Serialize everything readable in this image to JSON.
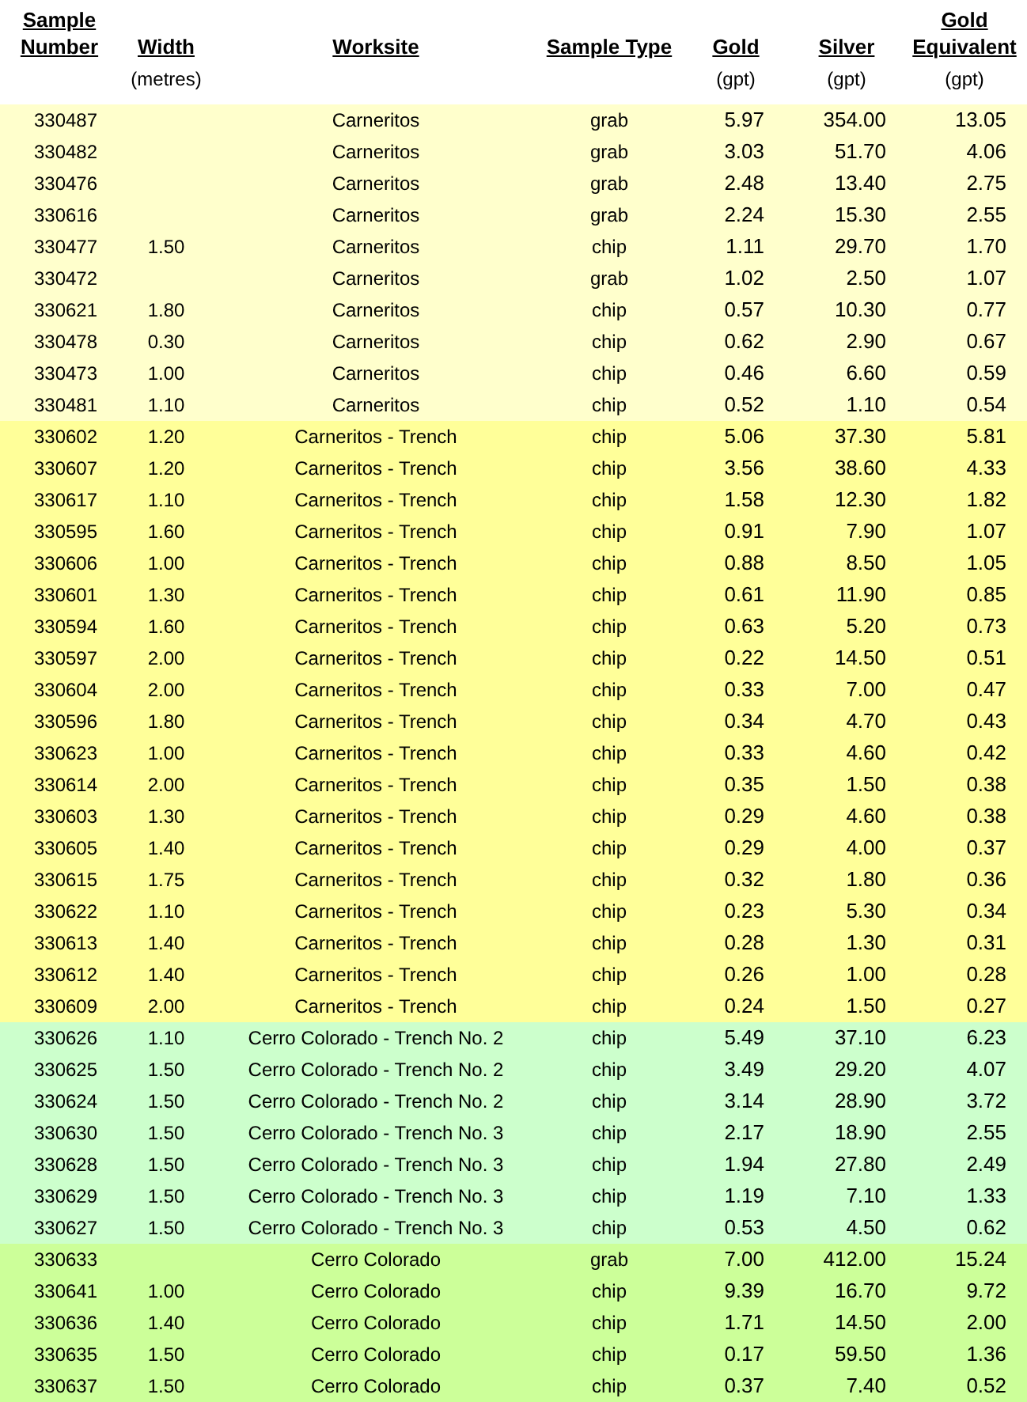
{
  "columns": [
    {
      "label": "Sample Number"
    },
    {
      "label": "Width",
      "unit": "(metres)"
    },
    {
      "label": "Worksite"
    },
    {
      "label": "Sample Type"
    },
    {
      "label": "Gold",
      "unit": "(gpt)"
    },
    {
      "label": "Silver",
      "unit": "(gpt)"
    },
    {
      "label": "Gold Equivalent",
      "unit": "(gpt)"
    }
  ],
  "groups": [
    {
      "color": "#ffffcc",
      "rows": [
        [
          "330487",
          "",
          "Carneritos",
          "grab",
          "5.97",
          "354.00",
          "13.05"
        ],
        [
          "330482",
          "",
          "Carneritos",
          "grab",
          "3.03",
          "51.70",
          "4.06"
        ],
        [
          "330476",
          "",
          "Carneritos",
          "grab",
          "2.48",
          "13.40",
          "2.75"
        ],
        [
          "330616",
          "",
          "Carneritos",
          "grab",
          "2.24",
          "15.30",
          "2.55"
        ],
        [
          "330477",
          "1.50",
          "Carneritos",
          "chip",
          "1.11",
          "29.70",
          "1.70"
        ],
        [
          "330472",
          "",
          "Carneritos",
          "grab",
          "1.02",
          "2.50",
          "1.07"
        ],
        [
          "330621",
          "1.80",
          "Carneritos",
          "chip",
          "0.57",
          "10.30",
          "0.77"
        ],
        [
          "330478",
          "0.30",
          "Carneritos",
          "chip",
          "0.62",
          "2.90",
          "0.67"
        ],
        [
          "330473",
          "1.00",
          "Carneritos",
          "chip",
          "0.46",
          "6.60",
          "0.59"
        ],
        [
          "330481",
          "1.10",
          "Carneritos",
          "chip",
          "0.52",
          "1.10",
          "0.54"
        ]
      ]
    },
    {
      "color": "#ffff99",
      "rows": [
        [
          "330602",
          "1.20",
          "Carneritos - Trench",
          "chip",
          "5.06",
          "37.30",
          "5.81"
        ],
        [
          "330607",
          "1.20",
          "Carneritos - Trench",
          "chip",
          "3.56",
          "38.60",
          "4.33"
        ],
        [
          "330617",
          "1.10",
          "Carneritos - Trench",
          "chip",
          "1.58",
          "12.30",
          "1.82"
        ],
        [
          "330595",
          "1.60",
          "Carneritos - Trench",
          "chip",
          "0.91",
          "7.90",
          "1.07"
        ],
        [
          "330606",
          "1.00",
          "Carneritos - Trench",
          "chip",
          "0.88",
          "8.50",
          "1.05"
        ],
        [
          "330601",
          "1.30",
          "Carneritos - Trench",
          "chip",
          "0.61",
          "11.90",
          "0.85"
        ],
        [
          "330594",
          "1.60",
          "Carneritos - Trench",
          "chip",
          "0.63",
          "5.20",
          "0.73"
        ],
        [
          "330597",
          "2.00",
          "Carneritos - Trench",
          "chip",
          "0.22",
          "14.50",
          "0.51"
        ],
        [
          "330604",
          "2.00",
          "Carneritos - Trench",
          "chip",
          "0.33",
          "7.00",
          "0.47"
        ],
        [
          "330596",
          "1.80",
          "Carneritos - Trench",
          "chip",
          "0.34",
          "4.70",
          "0.43"
        ],
        [
          "330623",
          "1.00",
          "Carneritos - Trench",
          "chip",
          "0.33",
          "4.60",
          "0.42"
        ],
        [
          "330614",
          "2.00",
          "Carneritos - Trench",
          "chip",
          "0.35",
          "1.50",
          "0.38"
        ],
        [
          "330603",
          "1.30",
          "Carneritos - Trench",
          "chip",
          "0.29",
          "4.60",
          "0.38"
        ],
        [
          "330605",
          "1.40",
          "Carneritos - Trench",
          "chip",
          "0.29",
          "4.00",
          "0.37"
        ],
        [
          "330615",
          "1.75",
          "Carneritos - Trench",
          "chip",
          "0.32",
          "1.80",
          "0.36"
        ],
        [
          "330622",
          "1.10",
          "Carneritos - Trench",
          "chip",
          "0.23",
          "5.30",
          "0.34"
        ],
        [
          "330613",
          "1.40",
          "Carneritos - Trench",
          "chip",
          "0.28",
          "1.30",
          "0.31"
        ],
        [
          "330612",
          "1.40",
          "Carneritos - Trench",
          "chip",
          "0.26",
          "1.00",
          "0.28"
        ],
        [
          "330609",
          "2.00",
          "Carneritos - Trench",
          "chip",
          "0.24",
          "1.50",
          "0.27"
        ]
      ]
    },
    {
      "color": "#ccffcc",
      "rows": [
        [
          "330626",
          "1.10",
          "Cerro Colorado - Trench No. 2",
          "chip",
          "5.49",
          "37.10",
          "6.23"
        ],
        [
          "330625",
          "1.50",
          "Cerro Colorado - Trench No. 2",
          "chip",
          "3.49",
          "29.20",
          "4.07"
        ],
        [
          "330624",
          "1.50",
          "Cerro Colorado - Trench No. 2",
          "chip",
          "3.14",
          "28.90",
          "3.72"
        ],
        [
          "330630",
          "1.50",
          "Cerro Colorado - Trench No. 3",
          "chip",
          "2.17",
          "18.90",
          "2.55"
        ],
        [
          "330628",
          "1.50",
          "Cerro Colorado - Trench No. 3",
          "chip",
          "1.94",
          "27.80",
          "2.49"
        ],
        [
          "330629",
          "1.50",
          "Cerro Colorado - Trench No. 3",
          "chip",
          "1.19",
          "7.10",
          "1.33"
        ],
        [
          "330627",
          "1.50",
          "Cerro Colorado - Trench No. 3",
          "chip",
          "0.53",
          "4.50",
          "0.62"
        ]
      ]
    },
    {
      "color": "#ccff99",
      "rows": [
        [
          "330633",
          "",
          "Cerro Colorado",
          "grab",
          "7.00",
          "412.00",
          "15.24"
        ],
        [
          "330641",
          "1.00",
          "Cerro Colorado",
          "chip",
          "9.39",
          "16.70",
          "9.72"
        ],
        [
          "330636",
          "1.40",
          "Cerro Colorado",
          "chip",
          "1.71",
          "14.50",
          "2.00"
        ],
        [
          "330635",
          "1.50",
          "Cerro Colorado",
          "chip",
          "0.17",
          "59.50",
          "1.36"
        ],
        [
          "330637",
          "1.50",
          "Cerro Colorado",
          "chip",
          "0.37",
          "7.40",
          "0.52"
        ]
      ]
    }
  ]
}
